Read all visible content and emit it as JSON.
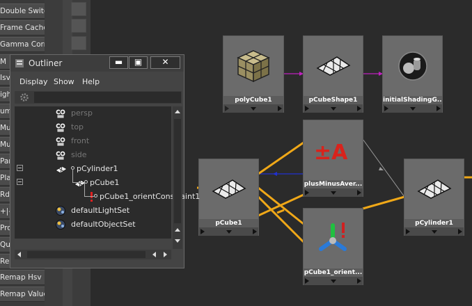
{
  "left_panel": {
    "buttons": [
      "Double Switch",
      "Frame Cache",
      "Gamma Correct",
      "M",
      "Isv",
      "ight",
      "um",
      "Mul",
      "Mul",
      "Par",
      "Pla",
      "Rd",
      "+|-",
      "Pro",
      "Qua",
      "Rer",
      "Remap Hsv",
      "Remap Value"
    ]
  },
  "outliner": {
    "title": "Outliner",
    "buttons": {
      "minimize": "▬",
      "maximize": "▣",
      "close": "✕"
    },
    "menu": {
      "display": "Display",
      "show": "Show",
      "help": "Help"
    },
    "search_value": "",
    "items": [
      {
        "label": "persp",
        "icon": "camera-icon",
        "state": "dim"
      },
      {
        "label": "top",
        "icon": "camera-icon",
        "state": "dim"
      },
      {
        "label": "front",
        "icon": "camera-icon",
        "state": "dim"
      },
      {
        "label": "side",
        "icon": "camera-icon",
        "state": "dim"
      },
      {
        "label": "pCylinder1",
        "icon": "mesh-icon",
        "state": "lit"
      },
      {
        "label": "pCube1",
        "icon": "mesh-icon",
        "state": "lit"
      },
      {
        "label": "pCube1_orientConstraint1",
        "icon": "constraint-icon",
        "state": "lit"
      },
      {
        "label": "defaultLightSet",
        "icon": "set-icon",
        "state": "lit"
      },
      {
        "label": "defaultObjectSet",
        "icon": "set-icon",
        "state": "lit"
      }
    ]
  },
  "graph": {
    "nodes": [
      {
        "id": "polyCube1",
        "label": "polyCube1",
        "icon": "poly-cube-icon"
      },
      {
        "id": "pCubeShape1",
        "label": "pCubeShape1",
        "icon": "mesh-shape-icon"
      },
      {
        "id": "initialShadingGroup",
        "label": "initialShadingG...",
        "icon": "shading-group-icon"
      },
      {
        "id": "plusMinusAverage",
        "label": "plusMinusAver...",
        "icon": "plus-minus-icon"
      },
      {
        "id": "pCube1",
        "label": "pCube1",
        "icon": "mesh-shape-icon"
      },
      {
        "id": "pCylinder1",
        "label": "pCylinder1",
        "icon": "mesh-shape-icon"
      },
      {
        "id": "pCube1_orient",
        "label": "pCube1_orient...",
        "icon": "orient-constraint-icon"
      }
    ],
    "edge_colors": {
      "mesh": "#c020c0",
      "transform": "#f0a818",
      "numeric": "#2030d0",
      "default": "#9a9a9a"
    }
  }
}
